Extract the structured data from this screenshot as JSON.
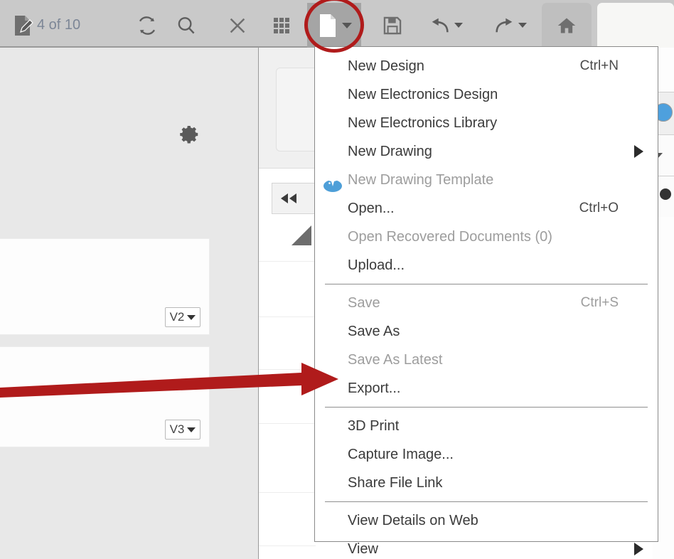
{
  "toolbar": {
    "doc_count_text": "4 of 10",
    "doc_count_icon": "document-edit-icon",
    "buttons": [
      {
        "name": "refresh-icon",
        "label": "Refresh"
      },
      {
        "name": "search-icon",
        "label": "Search"
      },
      {
        "name": "close-icon",
        "label": "Close"
      },
      {
        "name": "grid-icon",
        "label": "Grid View"
      },
      {
        "name": "new-file-icon",
        "label": "New"
      },
      {
        "name": "save-icon",
        "label": "Save"
      },
      {
        "name": "undo-icon",
        "label": "Undo"
      },
      {
        "name": "redo-icon",
        "label": "Redo"
      },
      {
        "name": "home-icon",
        "label": "Home"
      }
    ],
    "highlight_color": "#b01b1b"
  },
  "left_panel": {
    "gear_icon": "gear-icon",
    "version_buttons": [
      {
        "label": "V2"
      },
      {
        "label": "V3"
      }
    ]
  },
  "menu": {
    "items": [
      {
        "label": "New Design",
        "accel": "Ctrl+N",
        "disabled": false,
        "submenu": false,
        "icon": null
      },
      {
        "label": "New Electronics Design",
        "accel": "",
        "disabled": false,
        "submenu": false,
        "icon": null
      },
      {
        "label": "New Electronics Library",
        "accel": "",
        "disabled": false,
        "submenu": false,
        "icon": null
      },
      {
        "label": "New Drawing",
        "accel": "",
        "disabled": false,
        "submenu": true,
        "icon": null
      },
      {
        "label": "New Drawing Template",
        "accel": "",
        "disabled": true,
        "submenu": false,
        "icon": "sparkle-icon"
      },
      {
        "label": "Open...",
        "accel": "Ctrl+O",
        "disabled": false,
        "submenu": false,
        "icon": null
      },
      {
        "label": "Open Recovered Documents (0)",
        "accel": "",
        "disabled": true,
        "submenu": false,
        "icon": null
      },
      {
        "label": "Upload...",
        "accel": "",
        "disabled": false,
        "submenu": false,
        "icon": null
      },
      {
        "sep": true
      },
      {
        "label": "Save",
        "accel": "Ctrl+S",
        "disabled": true,
        "submenu": false,
        "icon": null
      },
      {
        "label": "Save As",
        "accel": "",
        "disabled": false,
        "submenu": false,
        "icon": null
      },
      {
        "label": "Save As Latest",
        "accel": "",
        "disabled": true,
        "submenu": false,
        "icon": null
      },
      {
        "label": "Export...",
        "accel": "",
        "disabled": false,
        "submenu": false,
        "icon": null
      },
      {
        "sep": true
      },
      {
        "label": "3D Print",
        "accel": "",
        "disabled": false,
        "submenu": false,
        "icon": null
      },
      {
        "label": "Capture Image...",
        "accel": "",
        "disabled": false,
        "submenu": false,
        "icon": null
      },
      {
        "label": "Share File Link",
        "accel": "",
        "disabled": false,
        "submenu": false,
        "icon": null
      },
      {
        "sep": true
      },
      {
        "label": "View Details on Web",
        "accel": "",
        "disabled": false,
        "submenu": false,
        "icon": null
      },
      {
        "label": "View",
        "accel": "",
        "disabled": false,
        "submenu": true,
        "icon": null
      }
    ]
  },
  "annotation": {
    "arrow_target_label": "Export...",
    "arrow_color": "#b01b1b",
    "circle_target_label": "New"
  }
}
